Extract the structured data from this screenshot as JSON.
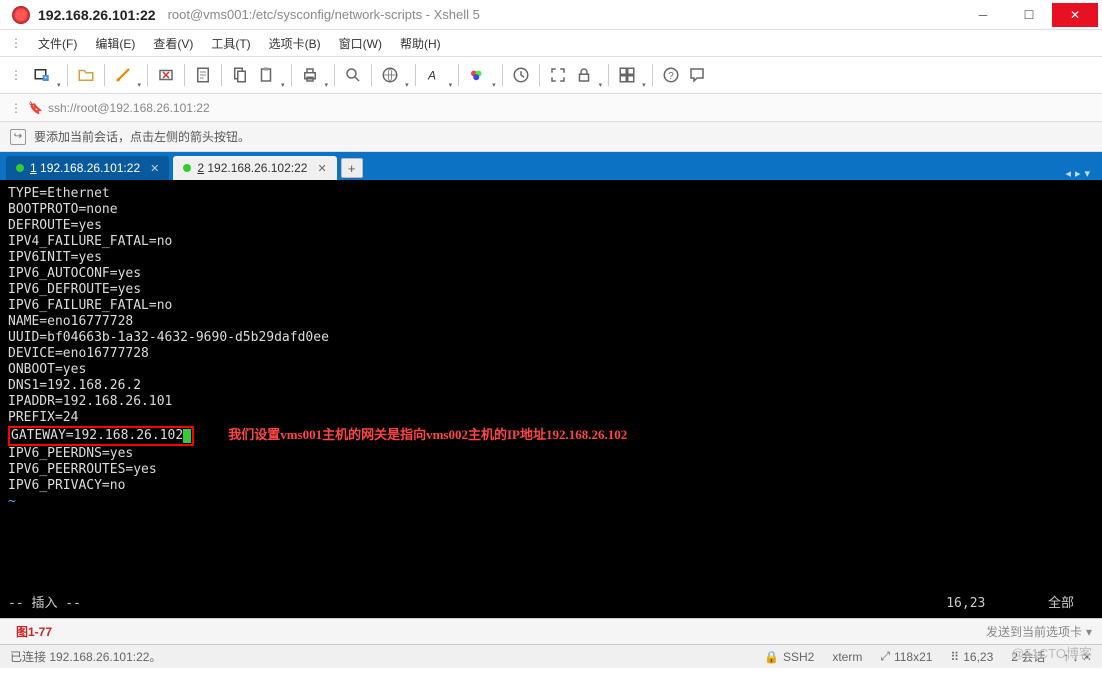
{
  "titlebar": {
    "host": "192.168.26.101:22",
    "path": "root@vms001:/etc/sysconfig/network-scripts - Xshell 5"
  },
  "menu": {
    "file": "文件(F)",
    "edit": "编辑(E)",
    "view": "查看(V)",
    "tools": "工具(T)",
    "tab": "选项卡(B)",
    "window": "窗口(W)",
    "help": "帮助(H)"
  },
  "addressbar": {
    "url": "ssh://root@192.168.26.101:22"
  },
  "hint": {
    "text": "要添加当前会话，点击左侧的箭头按钮。"
  },
  "tabs": {
    "active_num": "1",
    "active_label": " 192.168.26.101:22",
    "inactive_num": "2",
    "inactive_label": " 192.168.26.102:22"
  },
  "terminal": {
    "lines": [
      "TYPE=Ethernet",
      "BOOTPROTO=none",
      "DEFROUTE=yes",
      "IPV4_FAILURE_FATAL=no",
      "IPV6INIT=yes",
      "IPV6_AUTOCONF=yes",
      "IPV6_DEFROUTE=yes",
      "IPV6_FAILURE_FATAL=no",
      "NAME=eno16777728",
      "UUID=bf04663b-1a32-4632-9690-d5b29dafd0ee",
      "DEVICE=eno16777728",
      "ONBOOT=yes",
      "DNS1=192.168.26.2",
      "IPADDR=192.168.26.101",
      "PREFIX=24"
    ],
    "highlighted": "GATEWAY=192.168.26.102",
    "annotation": "我们设置vms001主机的网关是指向vms002主机的IP地址192.168.26.102",
    "after": [
      "IPV6_PEERDNS=yes",
      "IPV6_PEERROUTES=yes",
      "IPV6_PRIVACY=no"
    ],
    "tilde": "~",
    "mode": "-- 插入 --",
    "pos": "16,23",
    "scroll": "全部"
  },
  "bottombar": {
    "fig": "图1-77",
    "send": "发送到当前选项卡"
  },
  "statusbar": {
    "connected": "已连接 192.168.26.101:22。",
    "proto": "SSH2",
    "term": "xterm",
    "size": "118x21",
    "cursor": "16,23",
    "sessions": "2 会话"
  },
  "watermark": "@51CTO博客"
}
